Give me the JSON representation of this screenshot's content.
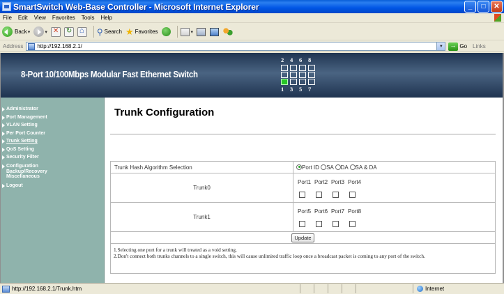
{
  "window": {
    "title": "SmartSwitch Web-Base Controller - Microsoft Internet Explorer",
    "controls": [
      "minimize",
      "maximize",
      "close"
    ]
  },
  "menu": [
    "File",
    "Edit",
    "View",
    "Favorites",
    "Tools",
    "Help"
  ],
  "toolbar": {
    "back_label": "Back",
    "search_label": "Search",
    "favorites_label": "Favorites"
  },
  "address": {
    "label": "Address",
    "url": "http://192.168.2.1/",
    "go_label": "Go",
    "links_label": "Links"
  },
  "banner": {
    "title": "8-Port 10/100Mbps Modular Fast Ethernet Switch",
    "port_top_labels": [
      "2",
      "4",
      "6",
      "8"
    ],
    "port_bottom_labels": [
      "1",
      "3",
      "5",
      "7"
    ],
    "active_port": "1"
  },
  "sidebar": {
    "items": [
      {
        "label": "Administrator"
      },
      {
        "label": "Port Management"
      },
      {
        "label": "VLAN Setting"
      },
      {
        "label": "Per Port Counter"
      },
      {
        "label": "Trunk Setting"
      },
      {
        "label": "QoS Setting"
      },
      {
        "label": "Security Filter"
      },
      {
        "label": "Configuration",
        "sub": "Backup/Recovery"
      },
      {
        "label": "Miscellaneous"
      },
      {
        "label": "Logout"
      }
    ],
    "current": "Trunk Setting"
  },
  "main": {
    "title": "Trunk Configuration",
    "hash_label": "Trunk Hash Algorithm Selection",
    "hash_options": [
      "Port ID",
      "SA",
      "DA",
      "SA & DA"
    ],
    "hash_selected": "Port ID",
    "trunks": [
      {
        "name": "Trunk0",
        "ports": [
          "Port1",
          "Port2",
          "Port3",
          "Port4"
        ]
      },
      {
        "name": "Trunk1",
        "ports": [
          "Port5",
          "Port6",
          "Port7",
          "Port8"
        ]
      }
    ],
    "update_label": "Update",
    "notes": [
      "1.Selecting one port for a trunk will treated as a void setting.",
      "2.Don't connect both trunks channels to a single switch, this will cause unlimited traffic loop once a broadcast packet is coming to any port of the switch."
    ]
  },
  "status": {
    "url": "http://192.168.2.1/Trunk.htm",
    "zone": "Internet"
  }
}
